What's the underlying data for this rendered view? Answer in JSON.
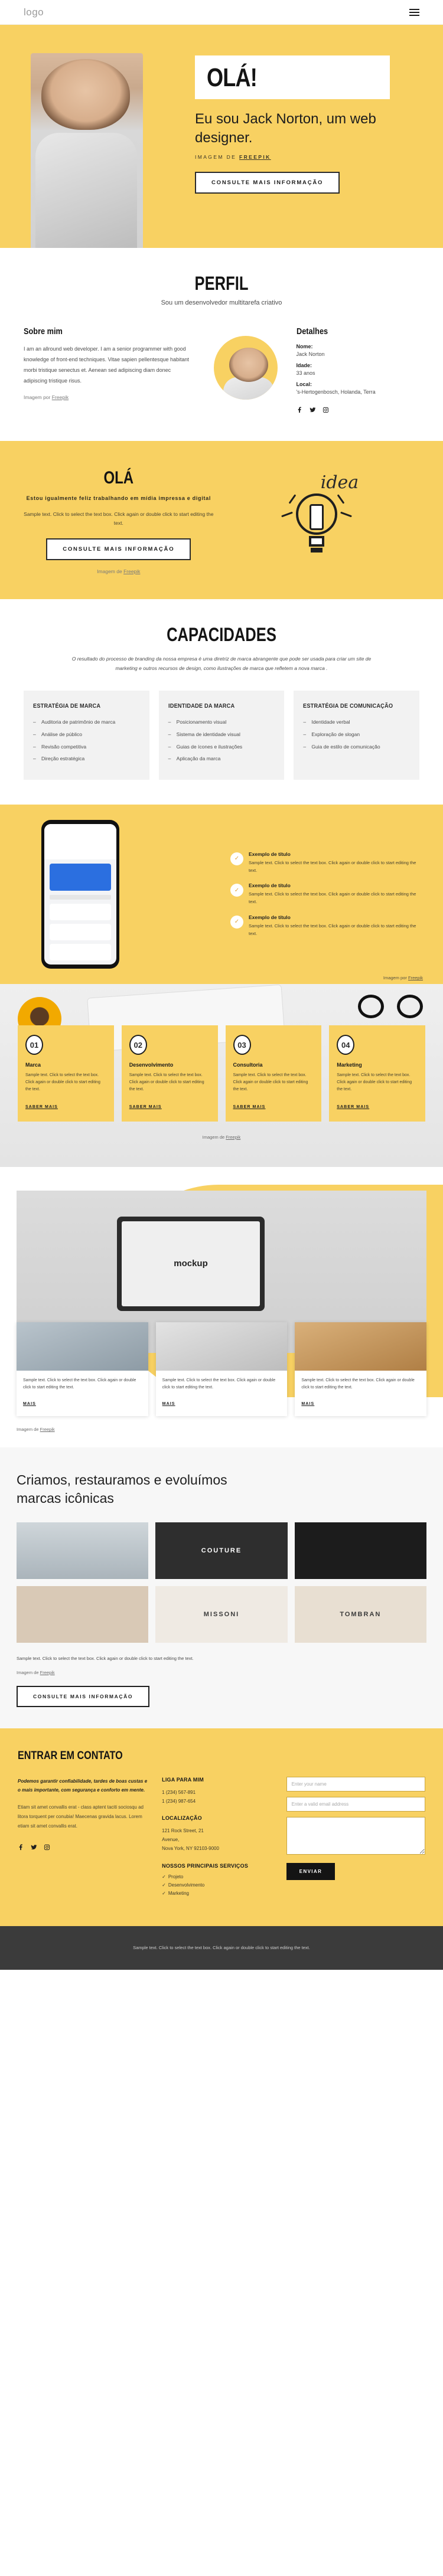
{
  "header": {
    "logo": "logo",
    "menu_icon": "hamburger-icon"
  },
  "hero": {
    "title": "OLÁ!",
    "subtitle": "Eu sou Jack Norton, um web designer.",
    "credit_prefix": "IMAGEM DE",
    "credit_link": "FREEPIK",
    "cta": "CONSULTE MAIS INFORMAÇÃO"
  },
  "profile": {
    "title": "PERFIL",
    "subtitle": "Sou um desenvolvedor multitarefa criativo",
    "about_heading": "Sobre mim",
    "about_text": "I am an allround web developer. I am a senior programmer with good knowledge of front-end techniques. Vitae sapien pellentesque habitant morbi tristique senectus et. Aenean sed adipiscing diam donec adipiscing tristique risus.",
    "about_credit_prefix": "Imagem por",
    "about_credit_link": "Freepik",
    "details_heading": "Detalhes",
    "details": [
      {
        "key": "Nome:",
        "value": "Jack Norton"
      },
      {
        "key": "Idade:",
        "value": "33 anos"
      },
      {
        "key": "Local:",
        "value": "'s-Hertogenbosch, Holanda, Terra"
      }
    ],
    "socials": [
      "facebook-icon",
      "twitter-icon",
      "instagram-icon"
    ]
  },
  "ola": {
    "title": "OLÁ",
    "tagline": "Estou igualmente feliz trabalhando em mídia impressa e digital",
    "body": "Sample text. Click to select the text box. Click again or double click to start editing the text.",
    "cta": "CONSULTE MAIS INFORMAÇÃO",
    "credit_prefix": "Imagem de",
    "credit_link": "Freepik",
    "idea_word": "idea"
  },
  "capabilities": {
    "title": "CAPACIDADES",
    "intro": "O resultado do processo de branding da nossa empresa é uma diretriz de marca abrangente que pode ser usada para criar um site de marketing e outros recursos de design, como ilustrações de marca que refletem a nova marca .",
    "intro_link": "site de marketing",
    "cards": [
      {
        "title": "ESTRATÉGIA DE MARCA",
        "items": [
          "Auditoria de patrimônio de marca",
          "Análise de público",
          "Revisão competitiva",
          "Direção estratégica"
        ]
      },
      {
        "title": "IDENTIDADE DA MARCA",
        "items": [
          "Posicionamento visual",
          "Sistema de identidade visual",
          "Guias de ícones e ilustrações",
          "Aplicação da marca"
        ]
      },
      {
        "title": "ESTRATÉGIA DE COMUNICAÇÃO",
        "items": [
          "Identidade verbal",
          "Exploração de slogan",
          "Guia de estilo de comunicação"
        ]
      }
    ]
  },
  "phone_band": {
    "steps": [
      {
        "title": "Exemplo de título",
        "body": "Sample text. Click to select the text box. Click again or double click to start editing the text."
      },
      {
        "title": "Exemplo de título",
        "body": "Sample text. Click to select the text box. Click again or double click to start editing the text."
      },
      {
        "title": "Exemplo de título",
        "body": "Sample text. Click to select the text box. Click again or double click to start editing the text."
      }
    ],
    "credit_prefix": "Imagem por",
    "credit_link": "Freepik"
  },
  "steps_section": {
    "cards": [
      {
        "num": "01",
        "title": "Marca",
        "body": "Sample text. Click to select the text box. Click again or double click to start editing the text.",
        "link": "SABER MAIS"
      },
      {
        "num": "02",
        "title": "Desenvolvimento",
        "body": "Sample text. Click to select the text box. Click again or double click to start editing the text.",
        "link": "SABER MAIS"
      },
      {
        "num": "03",
        "title": "Consultoria",
        "body": "Sample text. Click to select the text box. Click again or double click to start editing the text.",
        "link": "SABER MAIS"
      },
      {
        "num": "04",
        "title": "Marketing",
        "body": "Sample text. Click to select the text box. Click again or double click to start editing the text.",
        "link": "SABER MAIS"
      }
    ],
    "credit_prefix": "Imagem de",
    "credit_link": "Freepik"
  },
  "mockup": {
    "screen_label": "mockup",
    "cards": [
      {
        "body": "Sample text. Click to select the text box. Click again or double click to start editing the text.",
        "link": "MAIS"
      },
      {
        "body": "Sample text. Click to select the text box. Click again or double click to start editing the text.",
        "link": "MAIS"
      },
      {
        "body": "Sample text. Click to select the text box. Click again or double click to start editing the text.",
        "link": "MAIS"
      }
    ],
    "credit_prefix": "Imagem de",
    "credit_link": "Freepik"
  },
  "brands": {
    "heading": "Criamos, restauramos e evoluímos marcas icônicas",
    "tiles": [
      "",
      "COUTURE",
      "",
      "",
      "MISSONI",
      "TOMBRAN"
    ],
    "note": "Sample text. Click to select the text box. Click again or double click to start editing the text.",
    "credit_prefix": "Imagem de",
    "credit_link": "Freepik",
    "cta": "CONSULTE MAIS INFORMAÇÃO"
  },
  "contact": {
    "title": "ENTRAR EM CONTATO",
    "lead": "Podemos garantir confiabilidade, tardes de boas custas e o mais importante, com segurança e conforto em mente.",
    "text": "Etiam sit amet convallis erat - class aptent taciti sociosqu ad litora torquent per conubia! Maecenas gravida lacus. Lorem etiam sit amet convallis erat.",
    "socials": [
      "facebook-icon",
      "twitter-icon",
      "instagram-icon"
    ],
    "ligue_title": "LIGA PARA MIM",
    "phones": [
      "1 (234) 567-891",
      "1 (234) 987-654"
    ],
    "localizacao_title": "LOCALIZAÇÃO",
    "address": [
      "121 Rock Street, 21",
      "Avenue,",
      "Nova York, NY 92103-9000"
    ],
    "services_title": "NOSSOS PRINCIPAIS SERVIÇOS",
    "services": [
      "Projeto",
      "Desenvolvimento",
      "Marketing"
    ],
    "form": {
      "name_placeholder": "Enter your name",
      "email_placeholder": "Enter a valid email address",
      "message_placeholder": "",
      "submit": "ENVIAR"
    }
  },
  "footer": {
    "text": "Sample text. Click to select the text box. Click again or double click to start editing the text."
  },
  "colors": {
    "accent": "#f8d162",
    "dark": "#3b3b3b",
    "text": "#2b2b2b"
  }
}
